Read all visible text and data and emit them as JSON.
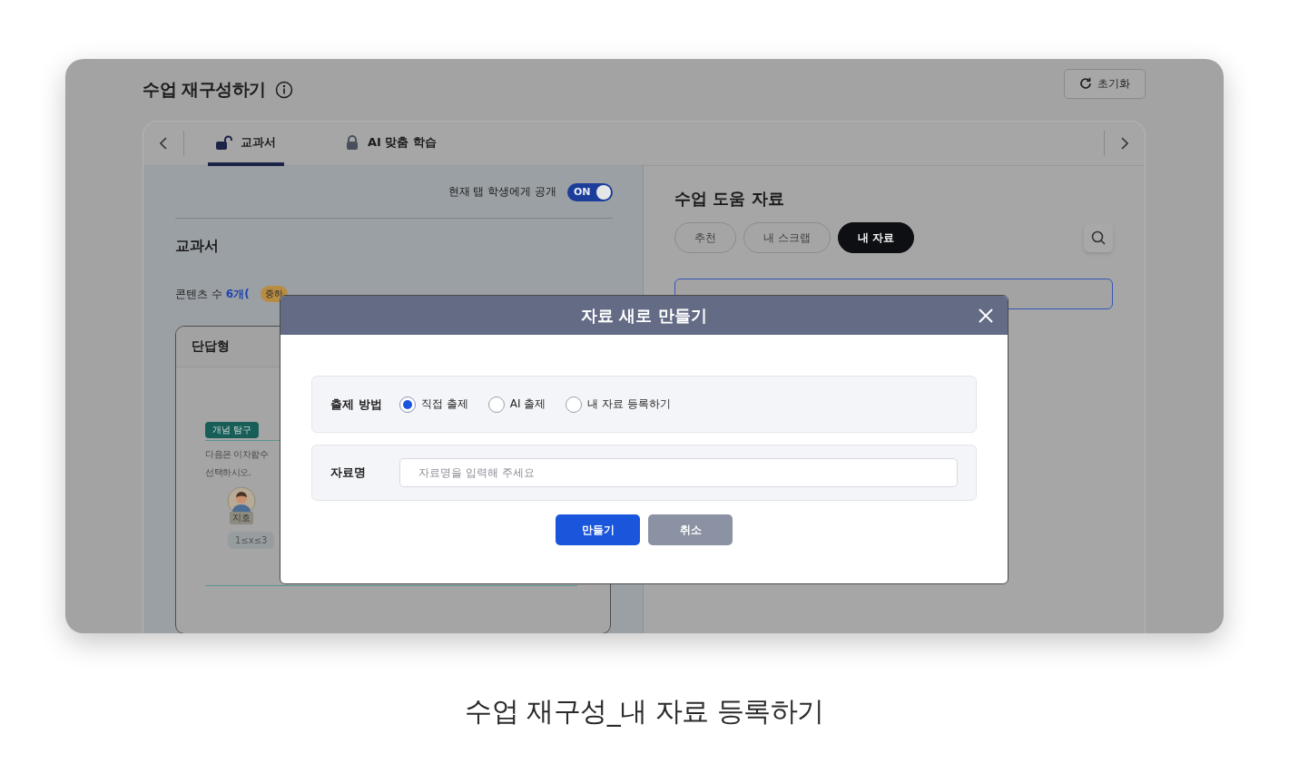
{
  "page": {
    "title": "수업 재구성하기",
    "reset_button": "초기화"
  },
  "tabs": [
    {
      "label": "교과서",
      "selected": true,
      "locked": false
    },
    {
      "label": "AI 맞춤 학습",
      "selected": false,
      "locked": true
    }
  ],
  "left_panel": {
    "visibility_label": "현재 탭 학생에게 공개",
    "visibility_toggle": {
      "label": "ON",
      "on": true
    },
    "heading": "교과서",
    "content_count": {
      "label": "콘텐츠 수",
      "count": "6개(",
      "badge": "중하"
    },
    "card": {
      "title": "단답형",
      "tag": "개념 탐구",
      "question_lines": [
        "다음은 이차함수",
        "선택하시오."
      ],
      "avatar_label": "지호",
      "answer_chip": "1≤x≤3"
    }
  },
  "right_panel": {
    "heading": "수업 도움 자료",
    "filters": [
      {
        "label": "추천",
        "selected": false
      },
      {
        "label": "내 스크랩",
        "selected": false
      },
      {
        "label": "내 자료",
        "selected": true
      }
    ]
  },
  "dialog": {
    "title": "자료 새로 만들기",
    "method_label": "출제 방법",
    "methods": [
      {
        "label": "직접 출제",
        "selected": true
      },
      {
        "label": "AI 출제",
        "selected": false
      },
      {
        "label": "내 자료 등록하기",
        "selected": false
      }
    ],
    "name_label": "자료명",
    "name_field": {
      "placeholder": "자료명을 입력해 주세요"
    },
    "buttons": [
      {
        "label": "만들기",
        "kind": "primary"
      },
      {
        "label": "취소",
        "kind": "secondary"
      }
    ]
  },
  "caption": "수업 재구성_내 자료 등록하기"
}
